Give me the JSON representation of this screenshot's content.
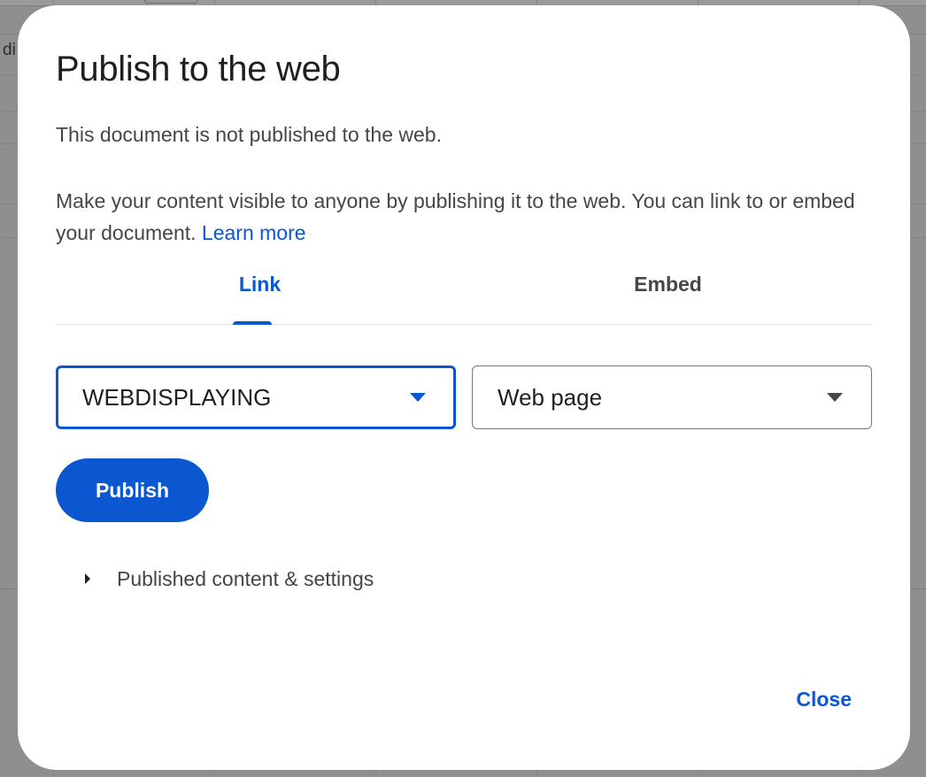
{
  "background": {
    "cell_text": "di"
  },
  "dialog": {
    "title": "Publish to the web",
    "status": "This document is not published to the web.",
    "description": "Make your content visible to anyone by publishing it to the web. You can link to or embed your document.",
    "learn_more": "Learn more",
    "tabs": [
      {
        "label": "Link",
        "selected": true
      },
      {
        "label": "Embed",
        "selected": false
      }
    ],
    "document_select": {
      "value": "WEBDISPLAYING"
    },
    "format_select": {
      "value": "Web page"
    },
    "publish_button": "Publish",
    "settings_expander": "Published content & settings",
    "close_button": "Close"
  },
  "colors": {
    "accent": "#0b57d0",
    "text_primary": "#1f1f1f",
    "text_secondary": "#444746"
  }
}
